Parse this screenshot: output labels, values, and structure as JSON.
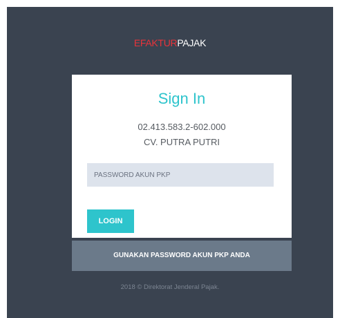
{
  "brand": {
    "part1": "EFAKTUR",
    "part2": "PAJAK"
  },
  "login_card": {
    "title": "Sign In",
    "npwp": "02.413.583.2-602.000",
    "company": "CV. PUTRA PUTRI",
    "password_placeholder": "PASSWORD AKUN PKP",
    "login_label": "LOGIN"
  },
  "hint": "GUNAKAN PASSWORD AKUN PKP ANDA",
  "footer": "2018 © Direktorat Jenderal Pajak.",
  "colors": {
    "background": "#3a4350",
    "accent": "#2ec4cc",
    "brand_red": "#e8333a",
    "hint_bar": "#6b7a8a",
    "input_bg": "#dde3ec"
  }
}
